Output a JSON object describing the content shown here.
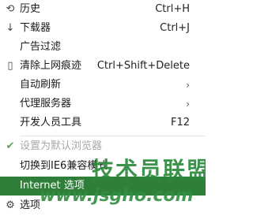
{
  "menu": {
    "items": [
      {
        "label": "历史",
        "shortcut": "Ctrl+H",
        "icon": "history-icon",
        "icon_glyph": "⟲"
      },
      {
        "label": "下载器",
        "shortcut": "Ctrl+J",
        "icon": "download-icon",
        "icon_glyph": "↓"
      },
      {
        "label": "广告过滤",
        "shortcut": ""
      },
      {
        "label": "清除上网痕迹",
        "shortcut": "Ctrl+Shift+Delete",
        "icon": "clear-icon",
        "icon_glyph": "▯"
      },
      {
        "label": "自动刷新",
        "submenu": true
      },
      {
        "label": "代理服务器",
        "submenu": true
      },
      {
        "label": "开发人员工具",
        "shortcut": "F12"
      },
      {
        "label": "设置为默认浏览器",
        "disabled": true,
        "checked": true,
        "icon": "check-icon",
        "icon_glyph": "✔"
      },
      {
        "label": "切换到IE6兼容模式"
      },
      {
        "label": "Internet 选项",
        "highlighted": true
      },
      {
        "label": "选项",
        "icon": "settings-icon",
        "icon_glyph": "⚙"
      }
    ],
    "arrow_glyph": "›"
  },
  "watermark": {
    "logo_text": "技术员联盟",
    "url": "www.jsgho.com"
  },
  "colors": {
    "highlight": "#2f7f3a",
    "watermark": "#2a8a3a",
    "disabled_text": "#a8a8a8"
  }
}
